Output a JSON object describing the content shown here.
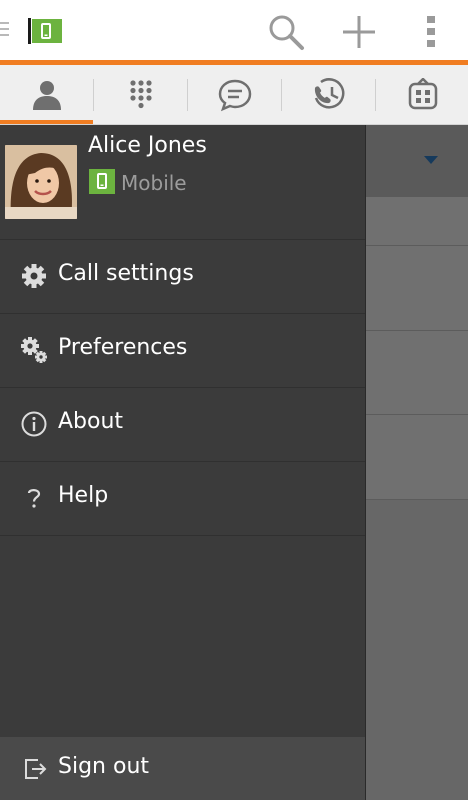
{
  "colors": {
    "accent": "#f07d22",
    "brand_green": "#6cb33f",
    "drawer_bg": "#3b3b3b"
  },
  "appbar": {
    "icons": [
      "menu-icon",
      "app-logo-icon",
      "search-icon",
      "add-icon",
      "overflow-menu-icon"
    ]
  },
  "tabs": [
    {
      "name": "contacts",
      "icon": "person-icon",
      "active": true
    },
    {
      "name": "dialpad",
      "icon": "dialpad-icon",
      "active": false
    },
    {
      "name": "messages",
      "icon": "chat-icon",
      "active": false
    },
    {
      "name": "history",
      "icon": "call-history-icon",
      "active": false
    },
    {
      "name": "apps",
      "icon": "apps-icon",
      "active": false
    }
  ],
  "profile": {
    "name": "Alice Jones",
    "status": "Mobile",
    "status_icon": "mobile-phone-icon"
  },
  "menu": [
    {
      "id": "call-settings",
      "label": "Call settings",
      "icon": "gear-icon"
    },
    {
      "id": "preferences",
      "label": "Preferences",
      "icon": "gears-icon"
    },
    {
      "id": "about",
      "label": "About",
      "icon": "info-icon"
    },
    {
      "id": "help",
      "label": "Help",
      "icon": "question-icon"
    }
  ],
  "signout": {
    "label": "Sign out",
    "icon": "sign-out-icon"
  }
}
